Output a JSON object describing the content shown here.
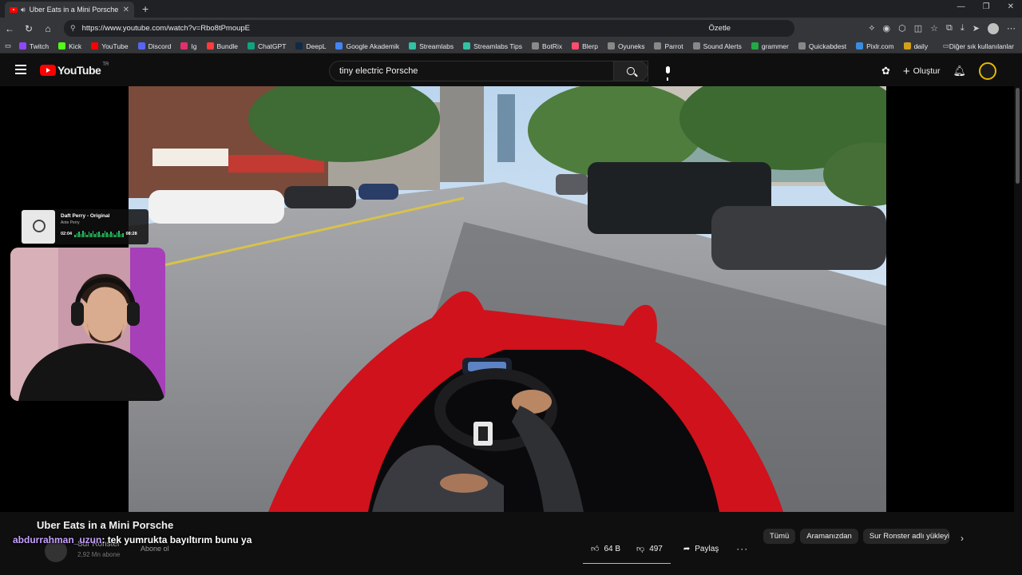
{
  "browser": {
    "tab_title": "Uber Eats in a Mini Porsche",
    "url": "https://www.youtube.com/watch?v=Rbo8tPmoupE",
    "ozetle_label": "Özetle",
    "bookmarks": [
      {
        "label": "Twitch",
        "color": "#9146ff"
      },
      {
        "label": "Kick",
        "color": "#53fc18"
      },
      {
        "label": "YouTube",
        "color": "#ff0000"
      },
      {
        "label": "Discord",
        "color": "#5865f2"
      },
      {
        "label": "Ig",
        "color": "#e1306c"
      },
      {
        "label": "Bundle",
        "color": "#ff3b3b"
      },
      {
        "label": "ChatGPT",
        "color": "#10a37f"
      },
      {
        "label": "DeepL",
        "color": "#0f2b46"
      },
      {
        "label": "Google Akademik",
        "color": "#4285f4"
      },
      {
        "label": "Streamlabs",
        "color": "#31c3a2"
      },
      {
        "label": "Streamlabs Tips",
        "color": "#31c3a2"
      },
      {
        "label": "BotRix",
        "color": "#8a8a8a"
      },
      {
        "label": "Blerp",
        "color": "#ff4d6d"
      },
      {
        "label": "Oyuneks",
        "color": "#888888"
      },
      {
        "label": "Parrot",
        "color": "#888888"
      },
      {
        "label": "Sound Alerts",
        "color": "#888888"
      },
      {
        "label": "grammer",
        "color": "#22aa44"
      },
      {
        "label": "Quickabdest",
        "color": "#888888"
      },
      {
        "label": "Pixlr.com",
        "color": "#3a8dde"
      },
      {
        "label": "daily",
        "color": "#d4a017"
      }
    ],
    "other_bookmarks": "Diğer sık kullanılanlar"
  },
  "youtube": {
    "logo_text": "YouTube",
    "region": "TR",
    "search_value": "tiny electric Porsche",
    "create_label": "Oluştur"
  },
  "overlay": {
    "song_title": "Daft Perry - Original",
    "artist": "Ante Perry",
    "time_elapsed": "02:04",
    "time_total": "08:28"
  },
  "video": {
    "title": "Uber Eats in a Mini Porsche",
    "channel": "Sur Ronster",
    "subscribers": "2,92 Mn abone",
    "subscribe_label": "Abone ol",
    "likes": "64 B",
    "dislikes": "497",
    "share_label": "Paylaş"
  },
  "chat": {
    "user": "abdurrahman_uzun",
    "message": ": tek yumrukta bayıltırım bunu ya"
  },
  "chips": [
    "Tümü",
    "Aramanızdan",
    "Sur Ronster adlı yükleyici"
  ],
  "colors": {
    "accent_red": "#ff0000",
    "background": "#0f0f0f",
    "chat_user": "#c7a2ff"
  }
}
